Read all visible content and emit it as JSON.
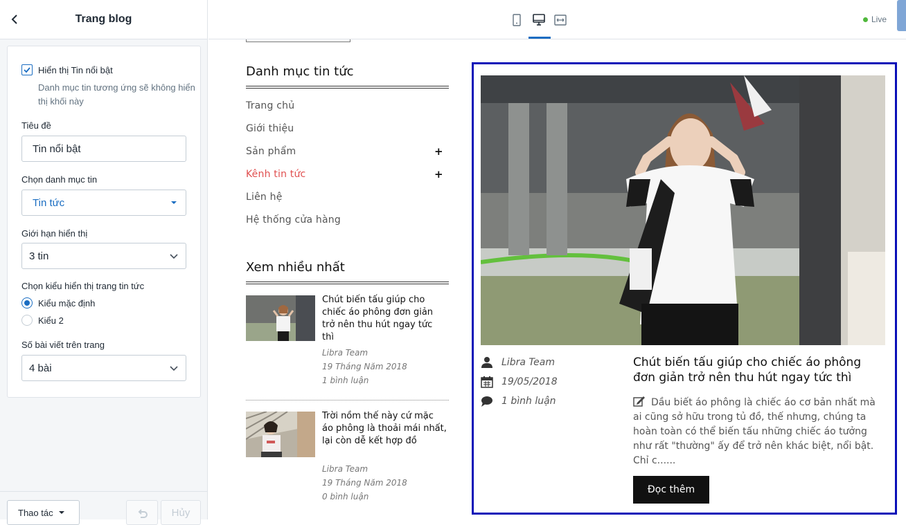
{
  "sidebar": {
    "title": "Trang blog",
    "show_featured_label": "Hiển thị Tin nổi bật",
    "show_featured_checked": true,
    "show_featured_help": "Danh mục tin tương ứng sẽ không hiển thị khối này",
    "heading_label": "Tiêu đề",
    "heading_value": "Tin nổi bật",
    "category_label": "Chọn danh mục tin",
    "category_value": "Tin tức",
    "limit_label": "Giới hạn hiển thị",
    "limit_value": "3 tin",
    "style_label": "Chọn kiểu hiển thị trang tin tức",
    "style_options": [
      {
        "label": "Kiểu mặc định",
        "selected": true
      },
      {
        "label": "Kiểu 2",
        "selected": false
      }
    ],
    "per_page_label": "Số bài viết trên trang",
    "per_page_value": "4 bài",
    "actions_label": "Thao tác",
    "cancel_label": "Hủy"
  },
  "topbar": {
    "live_label": "Live",
    "devices": [
      "mobile-icon",
      "desktop-icon",
      "fullwidth-icon"
    ],
    "active_device": "desktop-icon",
    "live_color": "#50b83c",
    "accent": "#1a6dc2"
  },
  "preview": {
    "categories_title": "Danh mục tin tức",
    "menu": [
      {
        "label": "Trang chủ",
        "expandable": false,
        "active": false
      },
      {
        "label": "Giới thiệu",
        "expandable": false,
        "active": false
      },
      {
        "label": "Sản phẩm",
        "expandable": true,
        "active": false
      },
      {
        "label": "Kênh tin tức",
        "expandable": true,
        "active": true
      },
      {
        "label": "Liên hệ",
        "expandable": false,
        "active": false
      },
      {
        "label": "Hệ thống cửa hàng",
        "expandable": false,
        "active": false
      }
    ],
    "expand_symbol": "+",
    "popular_title": "Xem nhiều nhất",
    "popular": [
      {
        "title": "Chút biến tấu giúp cho chiếc áo phông đơn giản trở nên thu hút ngay tức thì",
        "author": "Libra Team",
        "date": "19 Tháng Năm 2018",
        "comments": "1 bình luận"
      },
      {
        "title": "Trời nồm thế này cứ mặc áo phông là thoải mái nhất, lại còn dễ kết hợp đồ",
        "author": "Libra Team",
        "date": "19 Tháng Năm 2018",
        "comments": "0 bình luận"
      }
    ],
    "featured": {
      "author": "Libra Team",
      "date": "19/05/2018",
      "comments": "1 bình luận",
      "title": "Chút biến tấu giúp cho chiếc áo phông đơn giản trở nên thu hút ngay tức thì",
      "excerpt": "Dầu biết áo phông là chiếc áo cơ bản nhất mà ai cũng sở hữu trong tủ đồ, thế nhưng, chúng ta hoàn toàn có thể biến tấu những chiếc áo tưởng như rất \"thường\" ấy để trở nên khác biệt, nổi bật. Chỉ c......",
      "read_more": "Đọc thêm",
      "highlight_color": "#0b10b8",
      "active_menu_color": "#e05050"
    }
  }
}
